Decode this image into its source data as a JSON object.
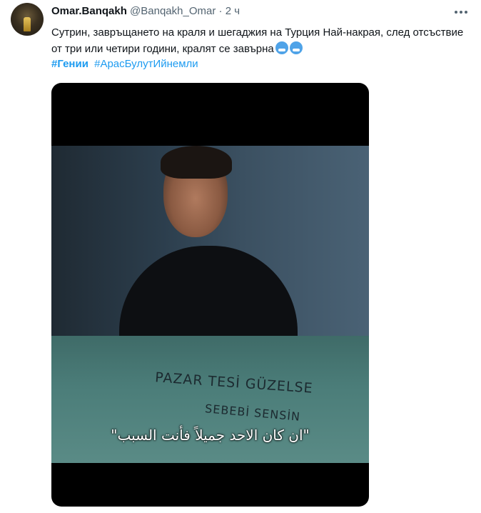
{
  "tweet": {
    "author_name": "Omar.Banqakh",
    "author_handle": "@Banqakh_Omar",
    "separator": "·",
    "time": "2 ч",
    "text": "Сутрин, завръщането на краля и шегаджия на Турция Най-накрая, след отсъствие от три или четири години, кралят се завърна",
    "emojis": [
      "cold-face-emoji",
      "cold-face-emoji"
    ],
    "hashtags": [
      "#Гении",
      "#АрасБулутИйнемли"
    ],
    "more_icon": "more-horizontal-icon"
  },
  "media": {
    "graffiti_line1": "PAZAR TESİ GÜZELSE",
    "graffiti_line2": "SEBEBİ SENSİN",
    "subtitle": "\"ان كان الاحد جميلاً فأنت السبب\""
  }
}
